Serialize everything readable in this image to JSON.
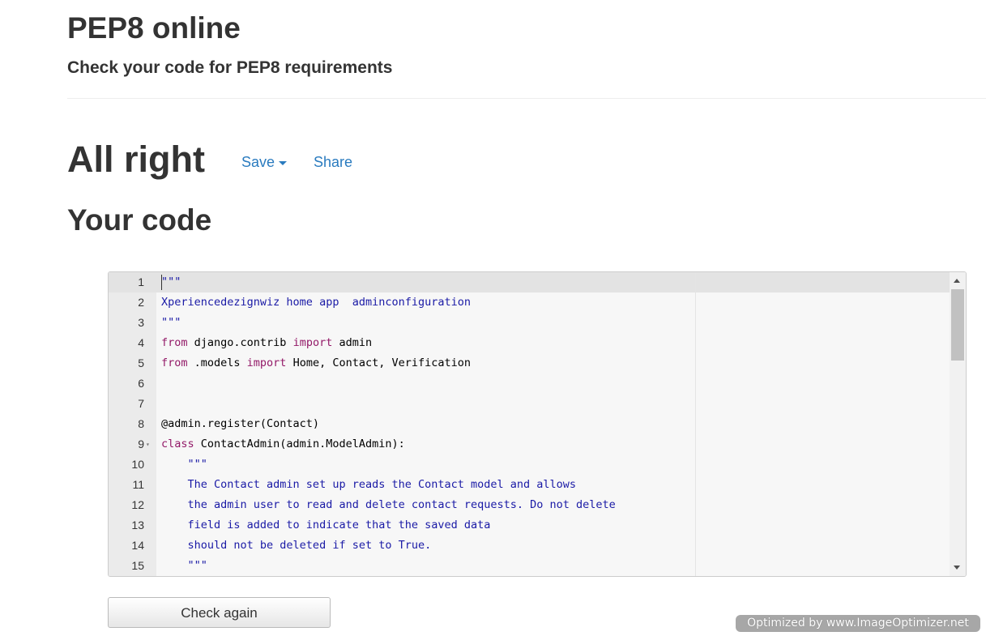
{
  "header": {
    "title": "PEP8 online",
    "subtitle": "Check your code for PEP8 requirements"
  },
  "result": {
    "title": "All right",
    "save_label": "Save",
    "share_label": "Share"
  },
  "code_section": {
    "title": "Your code"
  },
  "editor": {
    "lines": [
      {
        "num": "1",
        "fold": "",
        "tokens": [
          {
            "t": "\"\"\"",
            "c": "#1a1aa6"
          }
        ]
      },
      {
        "num": "2",
        "fold": "",
        "tokens": [
          {
            "t": "Xperiencedezignwiz home app  adminconfiguration",
            "c": "#1a1aa6"
          }
        ]
      },
      {
        "num": "3",
        "fold": "",
        "tokens": [
          {
            "t": "\"\"\"",
            "c": "#1a1aa6"
          }
        ]
      },
      {
        "num": "4",
        "fold": "",
        "tokens": [
          {
            "t": "from",
            "c": "#931a68"
          },
          {
            "t": " django.contrib ",
            "c": "#000000"
          },
          {
            "t": "import",
            "c": "#931a68"
          },
          {
            "t": " admin",
            "c": "#000000"
          }
        ]
      },
      {
        "num": "5",
        "fold": "",
        "tokens": [
          {
            "t": "from",
            "c": "#931a68"
          },
          {
            "t": " .models ",
            "c": "#000000"
          },
          {
            "t": "import",
            "c": "#931a68"
          },
          {
            "t": " Home, Contact, Verification",
            "c": "#000000"
          }
        ]
      },
      {
        "num": "6",
        "fold": "",
        "tokens": []
      },
      {
        "num": "7",
        "fold": "",
        "tokens": []
      },
      {
        "num": "8",
        "fold": "",
        "tokens": [
          {
            "t": "@admin.register(Contact)",
            "c": "#000000"
          }
        ]
      },
      {
        "num": "9",
        "fold": "▾",
        "tokens": [
          {
            "t": "class",
            "c": "#931a68"
          },
          {
            "t": " ContactAdmin(admin.ModelAdmin):",
            "c": "#000000"
          }
        ]
      },
      {
        "num": "10",
        "fold": "",
        "tokens": [
          {
            "t": "    \"\"\"",
            "c": "#1a1aa6"
          }
        ]
      },
      {
        "num": "11",
        "fold": "",
        "tokens": [
          {
            "t": "    The Contact admin set up reads the Contact model and allows",
            "c": "#1a1aa6"
          }
        ]
      },
      {
        "num": "12",
        "fold": "",
        "tokens": [
          {
            "t": "    the admin user to read and delete contact requests. Do not delete",
            "c": "#1a1aa6"
          }
        ]
      },
      {
        "num": "13",
        "fold": "",
        "tokens": [
          {
            "t": "    field is added to indicate that the saved data",
            "c": "#1a1aa6"
          }
        ]
      },
      {
        "num": "14",
        "fold": "",
        "tokens": [
          {
            "t": "    should not be deleted if set to True.",
            "c": "#1a1aa6"
          }
        ]
      },
      {
        "num": "15",
        "fold": "",
        "tokens": [
          {
            "t": "    \"\"\"",
            "c": "#1a1aa6"
          }
        ]
      }
    ]
  },
  "actions": {
    "check_again_label": "Check again"
  },
  "watermark": {
    "text": "Optimized by www.ImageOptimizer.net"
  },
  "colors": {
    "link": "#2a7bbf",
    "keyword": "#931a68",
    "string": "#1a1aa6"
  }
}
